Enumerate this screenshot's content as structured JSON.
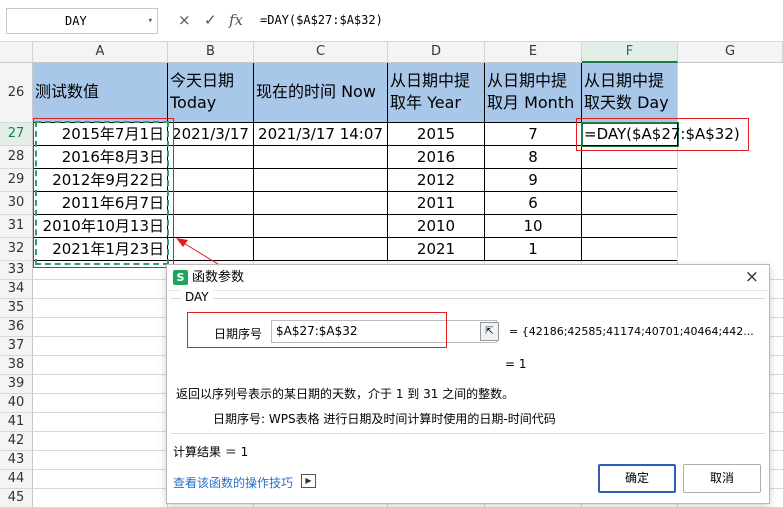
{
  "formula_bar": {
    "name_box": "DAY",
    "cancel_icon": "×",
    "confirm_icon": "✓",
    "fx_icon": "fx",
    "formula": "=DAY($A$27:$A$32)"
  },
  "columns": [
    "A",
    "B",
    "C",
    "D",
    "E",
    "F",
    "G"
  ],
  "active_column": "F",
  "rows": [
    "26",
    "27",
    "28",
    "29",
    "30",
    "31",
    "32",
    "33",
    "34",
    "35",
    "36",
    "37",
    "38",
    "39",
    "40",
    "41",
    "42",
    "43",
    "44",
    "45"
  ],
  "active_row": "27",
  "headers": {
    "a": "测试数值",
    "b": "今天日期 Today",
    "c": "现在的时间 Now",
    "d": "从日期中提取年 Year",
    "e": "从日期中提取月 Month",
    "f": "从日期中提取天数 Day"
  },
  "col_a": [
    "2015年7月1日",
    "2016年8月3日",
    "2012年9月22日",
    "2011年6月7日",
    "2010年10月13日",
    "2021年1月23日"
  ],
  "b27": "2021/3/17",
  "c27": "2021/3/17 14:07",
  "col_d": [
    "2015",
    "2016",
    "2012",
    "2011",
    "2010",
    "2021"
  ],
  "col_e": [
    "7",
    "8",
    "9",
    "6",
    "10",
    "1"
  ],
  "f27": "=DAY($A$27:$A$32)",
  "dialog": {
    "title": "函数参数",
    "close_label": "×",
    "function_name": "DAY",
    "arg_label": "日期序号",
    "arg_value": "$A$27:$A$32",
    "arg_result": "= {42186;42585;41174;40701;40464;442...",
    "eq_result": "= 1",
    "description": "返回以序列号表示的某日期的天数，介于 1 到 31 之间的整数。",
    "arg_description": "日期序号:   WPS表格 进行日期及时间计算时使用的日期-时间代码",
    "calc_result": "计算结果 ＝ 1",
    "help_link": "查看该函数的操作技巧",
    "ok_label": "确定",
    "cancel_label": "取消"
  }
}
